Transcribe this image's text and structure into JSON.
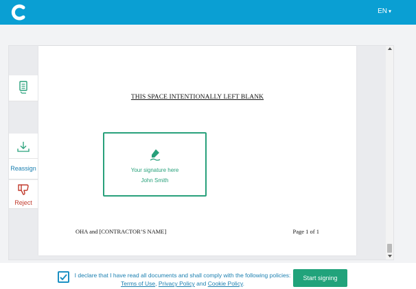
{
  "header": {
    "brand_color": "#0a9fd3",
    "logo_icon": "c-logo-icon",
    "language": "EN",
    "language_caret": "▾"
  },
  "sidebar": {
    "document_icon": "document-icon",
    "download_icon": "download-icon",
    "reassign_label": "Reassign",
    "reject_icon": "thumbs-down-icon",
    "reject_label": "Reject"
  },
  "document": {
    "blank_notice": "THIS SPACE INTENTIONALLY LEFT BLANK",
    "signature": {
      "icon": "pen-icon",
      "label": "Your signature here",
      "name": "John Smith",
      "accent_color": "#27a07a"
    },
    "footer_left": "OHA and [CONTRACTOR’S NAME]",
    "footer_right": "Page 1 of 1"
  },
  "consent": {
    "checked": true,
    "text_before": "I declare that I have read all documents and shall comply with the following policies:",
    "terms": "Terms of Use",
    "comma": ",",
    "privacy": "Privacy Policy",
    "and": "and",
    "cookie": "Cookie Policy",
    "period": ".",
    "button": "Start signing",
    "button_color": "#21a37b"
  }
}
